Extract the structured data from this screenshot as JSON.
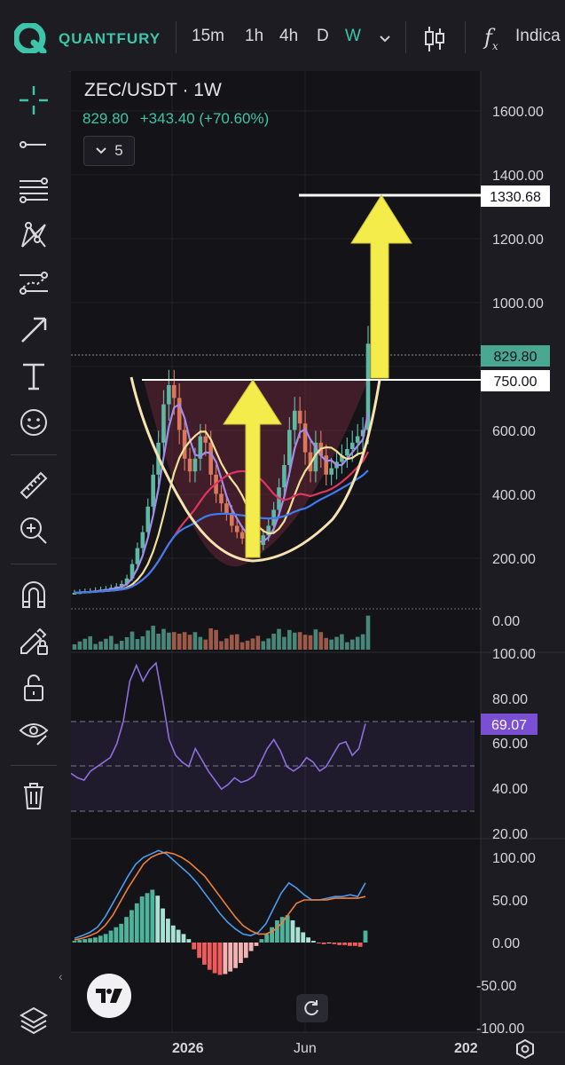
{
  "app": {
    "brand": "QUANTFURY"
  },
  "toolbar": {
    "intervals": [
      "15m",
      "1h",
      "4h",
      "D",
      "W"
    ],
    "active_interval": "W",
    "indicators_label": "Indica"
  },
  "symbol": {
    "title": "ZEC/USDT · 1W",
    "price": "829.80",
    "change": "+343.40 (+70.60%)",
    "collapse_count": "5"
  },
  "colors": {
    "accent": "#3ec4a8",
    "up": "#5fb8a4",
    "down": "#d9785c",
    "ma_purple": "#a38ce8",
    "ma_yellow": "#f3df97",
    "ma_red": "#e0355f",
    "ma_blue": "#3f7cf0",
    "arrow": "#f3ec4a",
    "rsi_label": "#7b4fd3",
    "macd_blue": "#4b9bf0",
    "macd_orange": "#ef7f3a"
  },
  "main_axis": {
    "ticks": [
      "1600.00",
      "1400.00",
      "1200.00",
      "1000.00",
      "600.00",
      "400.00",
      "200.00",
      "0.00"
    ],
    "labels": {
      "target": "1330.68",
      "current": "829.80",
      "neckline": "750.00"
    }
  },
  "rsi": {
    "ticks": [
      "100.00",
      "80.00",
      "60.00",
      "40.00",
      "20.00"
    ],
    "value": "69.07"
  },
  "macd": {
    "ticks": [
      "100.00",
      "50.00",
      "0.00",
      "-50.00",
      "-100.00"
    ]
  },
  "time_axis": [
    "2026",
    "Jun",
    "202"
  ],
  "sidebar_icons": [
    "crosshair-icon",
    "trend-line-icon",
    "fib-lines-icon",
    "pattern-icon",
    "forecast-icon",
    "arrow-icon",
    "text-icon",
    "emoji-icon",
    "ruler-icon",
    "zoom-in-icon",
    "magnet-icon",
    "lock-drawings-icon",
    "unlock-icon",
    "visibility-icon",
    "trash-icon",
    "layers-icon"
  ],
  "chart_data": [
    {
      "type": "candlestick",
      "series": [
        {
          "name": "MA",
          "color": "#a38ce8"
        },
        {
          "name": "MA",
          "color": "#f3df97"
        },
        {
          "name": "MA",
          "color": "#e0355f"
        },
        {
          "name": "MA",
          "color": "#3f7cf0"
        }
      ],
      "price_levels": [
        1330.68,
        829.8,
        750.0
      ],
      "ylim": [
        -60,
        1730
      ],
      "x_labels": [
        "2026",
        "Jun",
        "202"
      ],
      "closes": [
        50,
        52,
        54,
        55,
        58,
        60,
        62,
        66,
        70,
        78,
        95,
        140,
        190,
        240,
        320,
        420,
        520,
        640,
        700,
        660,
        560,
        470,
        430,
        470,
        540,
        520,
        420,
        360,
        330,
        300,
        260,
        240,
        220,
        210,
        205,
        200,
        230,
        260,
        310,
        380,
        450,
        560,
        620,
        580,
        490,
        430,
        520,
        480,
        420,
        440,
        460,
        480,
        500,
        520,
        540,
        560,
        829.8
      ],
      "volume_color_note": "green/red volume bars",
      "annotations": [
        "cup-shaped arc",
        "yellow up arrows",
        "neckline 750.00",
        "target 1330.68"
      ]
    },
    {
      "type": "line",
      "name": "RSI",
      "ylim": [
        15,
        105
      ],
      "levels": [
        70,
        50,
        30
      ],
      "values": [
        47,
        45,
        44,
        48,
        50,
        52,
        54,
        60,
        70,
        88,
        95,
        88,
        93,
        96,
        80,
        62,
        55,
        52,
        50,
        58,
        53,
        48,
        44,
        40,
        42,
        45,
        43,
        44,
        46,
        52,
        58,
        62,
        57,
        50,
        48,
        50,
        54,
        52,
        48,
        50,
        55,
        60,
        61,
        55,
        58,
        69.07
      ]
    },
    {
      "type": "bar",
      "name": "MACD",
      "ylim": [
        -120,
        120
      ],
      "histogram": [
        2,
        3,
        4,
        5,
        6,
        8,
        10,
        14,
        18,
        22,
        30,
        38,
        46,
        54,
        58,
        62,
        55,
        40,
        28,
        20,
        15,
        10,
        4,
        -8,
        -18,
        -26,
        -32,
        -36,
        -38,
        -37,
        -34,
        -30,
        -24,
        -18,
        -10,
        -4,
        4,
        10,
        18,
        26,
        30,
        32,
        26,
        18,
        12,
        6,
        2,
        -1,
        -2,
        -1,
        -2,
        -3,
        -3,
        -4,
        -4,
        -5,
        14
      ],
      "macd": [
        5,
        8,
        12,
        18,
        30,
        46,
        62,
        78,
        92,
        100,
        104,
        108,
        104,
        96,
        88,
        80,
        70,
        58,
        46,
        34,
        24,
        16,
        10,
        8,
        12,
        22,
        40,
        58,
        70,
        64,
        56,
        50,
        50,
        52,
        54,
        54,
        56,
        54,
        70
      ],
      "signal": [
        3,
        5,
        8,
        12,
        20,
        32,
        48,
        64,
        78,
        92,
        100,
        104,
        106,
        104,
        100,
        94,
        86,
        78,
        66,
        54,
        42,
        30,
        20,
        14,
        10,
        10,
        14,
        22,
        34,
        46,
        50,
        50,
        50,
        50,
        52,
        52,
        52,
        52,
        54
      ]
    }
  ]
}
